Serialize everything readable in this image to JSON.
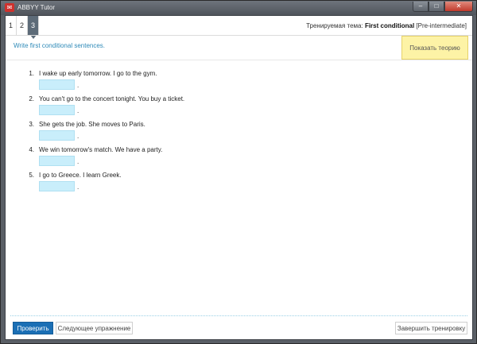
{
  "window": {
    "title": "ABBYY Tutor",
    "icon": "abbyy-app-icon",
    "controls": {
      "minimize": "–",
      "maximize": "□",
      "close": "✕"
    }
  },
  "tabs": [
    {
      "label": "1",
      "active": false
    },
    {
      "label": "2",
      "active": false
    },
    {
      "label": "3",
      "active": true
    }
  ],
  "topic": {
    "prefix": "Тренируемая тема:",
    "name": "First conditional",
    "level": "[Pre-intermediate]"
  },
  "instruction": "Write first conditional sentences.",
  "theory_button": "Показать теорию",
  "exercises": [
    {
      "num": "1.",
      "text": "I wake up early tomorrow. I go to the gym.",
      "value": "",
      "dot": "."
    },
    {
      "num": "2.",
      "text": "You can't go to the concert tonight. You buy a ticket.",
      "value": "",
      "dot": "."
    },
    {
      "num": "3.",
      "text": "She gets the job. She moves to Paris.",
      "value": "",
      "dot": "."
    },
    {
      "num": "4.",
      "text": "We win tomorrow's match. We have a party.",
      "value": "",
      "dot": "."
    },
    {
      "num": "5.",
      "text": "I go to Greece. I learn Greek.",
      "value": "",
      "dot": "."
    }
  ],
  "buttons": {
    "check": "Проверить",
    "next": "Следующее упражнение",
    "finish": "Завершить тренировку"
  },
  "colors": {
    "accent": "#1b6fb5",
    "instruction": "#2e8ab8",
    "input_bg": "#c9eefb",
    "theory_bg": "#fdf3a6"
  }
}
